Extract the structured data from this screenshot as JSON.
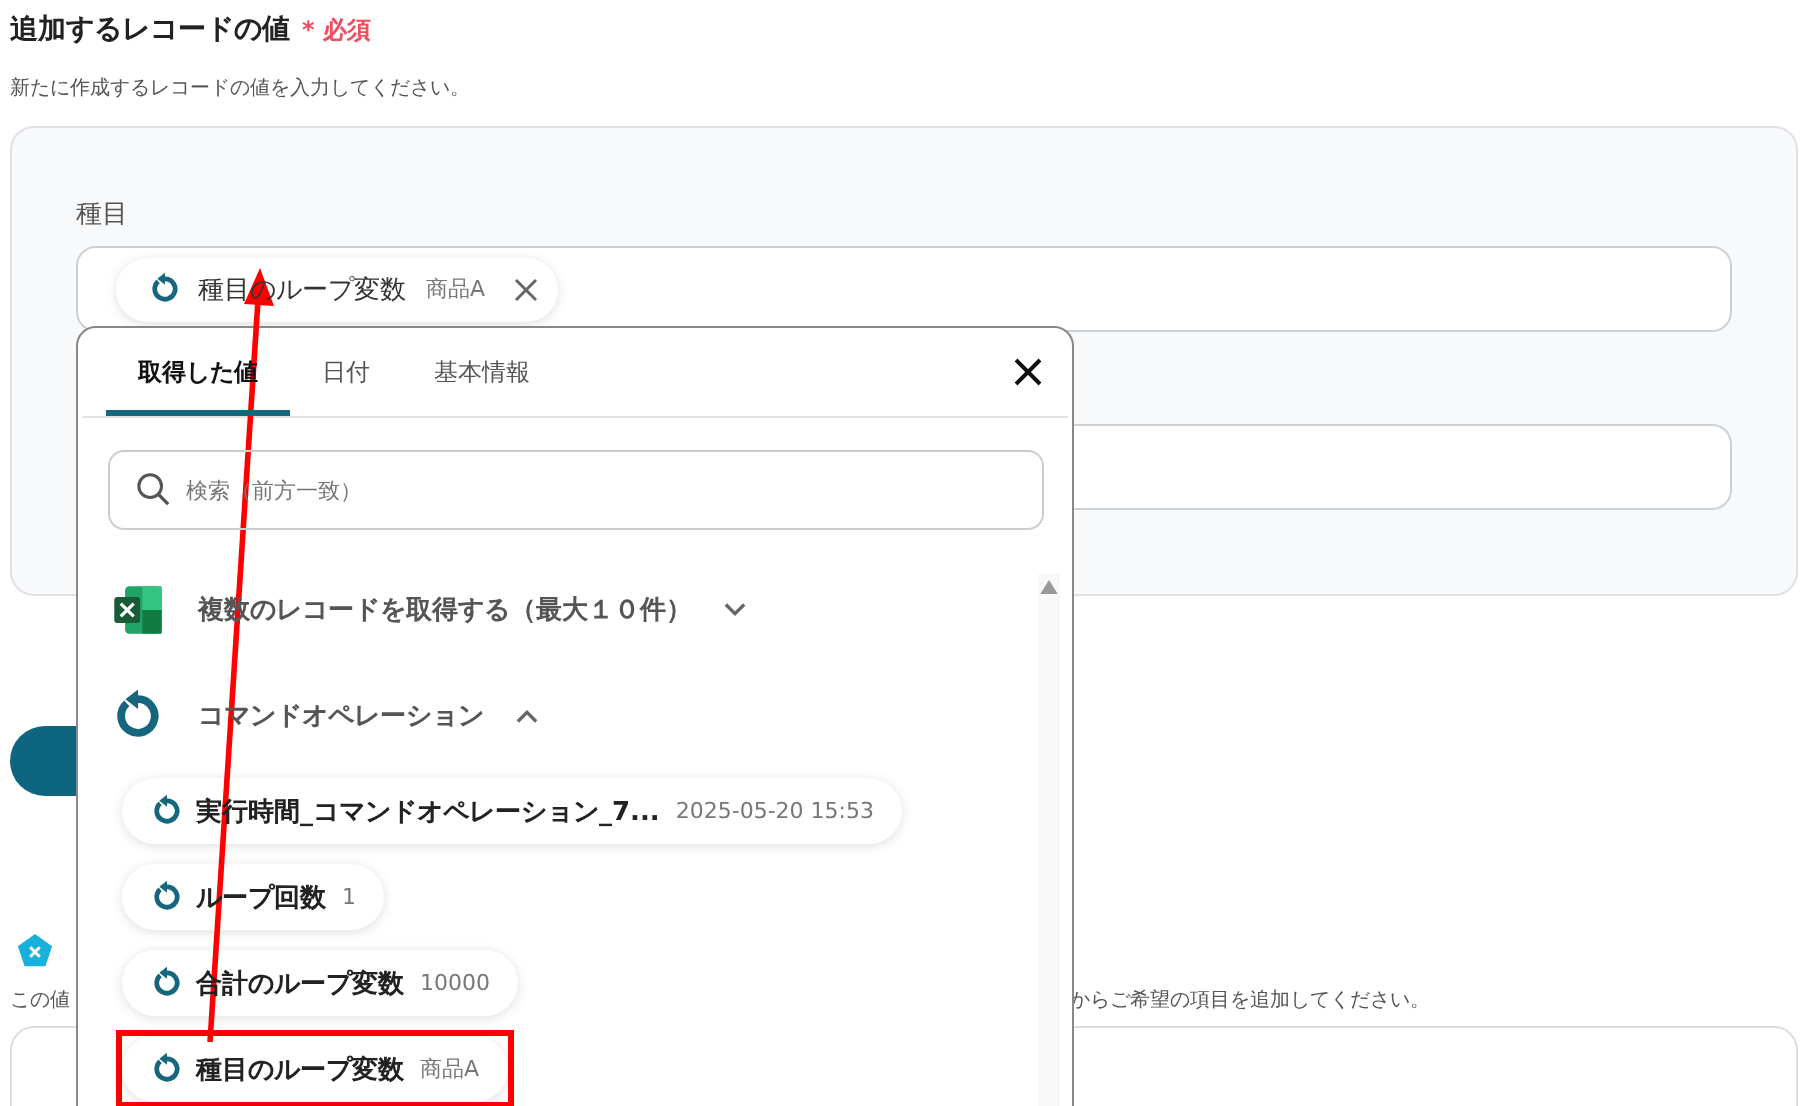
{
  "section": {
    "title": "追加するレコードの値",
    "required_mark": "*",
    "required": "必須",
    "description": "新たに作成するレコードの値を入力してください。"
  },
  "field": {
    "label": "種目",
    "chip": {
      "name": "種目のループ変数",
      "value": "商品A"
    }
  },
  "background_text": {
    "left": "この値",
    "right": "からご希望の項目を追加してください。"
  },
  "popup": {
    "tabs": [
      {
        "label": "取得した値",
        "selected": true
      },
      {
        "label": "日付",
        "selected": false
      },
      {
        "label": "基本情報",
        "selected": false
      }
    ],
    "search": {
      "placeholder": "検索（前方一致）"
    },
    "groups": [
      {
        "kind": "excel",
        "title": "複数のレコードを取得する（最大１０件）",
        "expanded": false
      },
      {
        "kind": "loop",
        "title": "コマンドオペレーション",
        "expanded": true,
        "items": [
          {
            "name": "実行時間_コマンドオペレーション_7...",
            "value": "2025-05-20 15:53",
            "highlighted": false
          },
          {
            "name": "ループ回数",
            "value": "1",
            "highlighted": false
          },
          {
            "name": "合計のループ変数",
            "value": "10000",
            "highlighted": false
          },
          {
            "name": "種目のループ変数",
            "value": "商品A",
            "highlighted": true
          }
        ]
      }
    ]
  }
}
